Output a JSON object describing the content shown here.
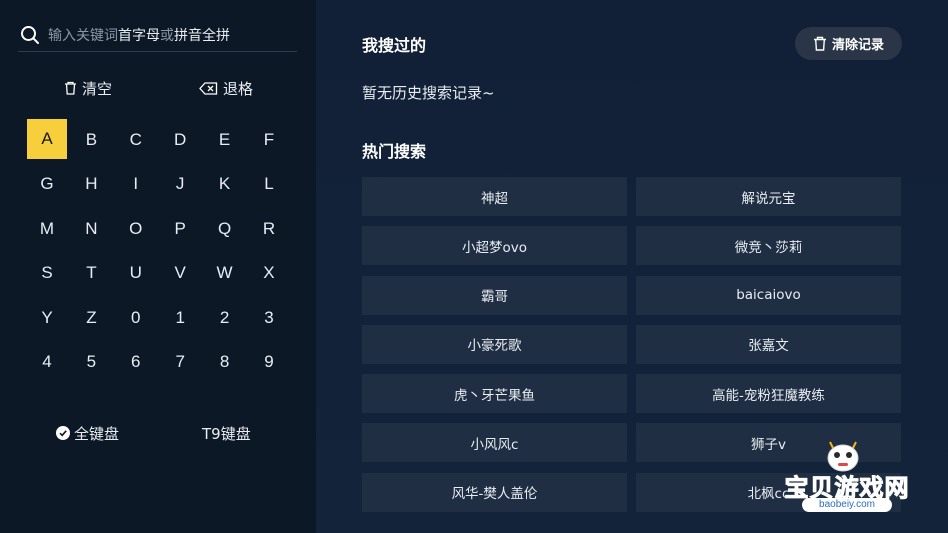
{
  "search": {
    "placeholder_prefix": "输入关键词",
    "placeholder_highlight_1": "首字母",
    "placeholder_mid": "或",
    "placeholder_highlight_2": "拼音全拼"
  },
  "keyboard": {
    "clear_label": "清空",
    "backspace_label": "退格",
    "keys": [
      "A",
      "B",
      "C",
      "D",
      "E",
      "F",
      "G",
      "H",
      "I",
      "J",
      "K",
      "L",
      "M",
      "N",
      "O",
      "P",
      "Q",
      "R",
      "S",
      "T",
      "U",
      "V",
      "W",
      "X",
      "Y",
      "Z",
      "0",
      "1",
      "2",
      "3",
      "4",
      "5",
      "6",
      "7",
      "8",
      "9"
    ],
    "active_key": "A",
    "mode_full_label": "全键盘",
    "mode_t9_label": "T9键盘"
  },
  "history": {
    "title": "我搜过的",
    "clear_button_label": "清除记录",
    "empty_text": "暂无历史搜索记录~"
  },
  "hot": {
    "title": "热门搜索",
    "items": [
      "神超",
      "解说元宝",
      "小超梦ovo",
      "微竞丶莎莉",
      "霸哥",
      "baicaiovo",
      "小豪死歌",
      "张嘉文",
      "虎丶牙芒果鱼",
      "高能-宠粉狂魔教练",
      "小风风c",
      "狮子v",
      "风华-樊人盖伦",
      "北枫cc"
    ]
  },
  "watermark": {
    "text": "宝贝游戏网",
    "url": "baobeiy.com"
  },
  "colors": {
    "accent": "#f7cf3d",
    "panel_left": "#0d1827",
    "panel_right": "#112036",
    "tile": "#1f2e42"
  }
}
